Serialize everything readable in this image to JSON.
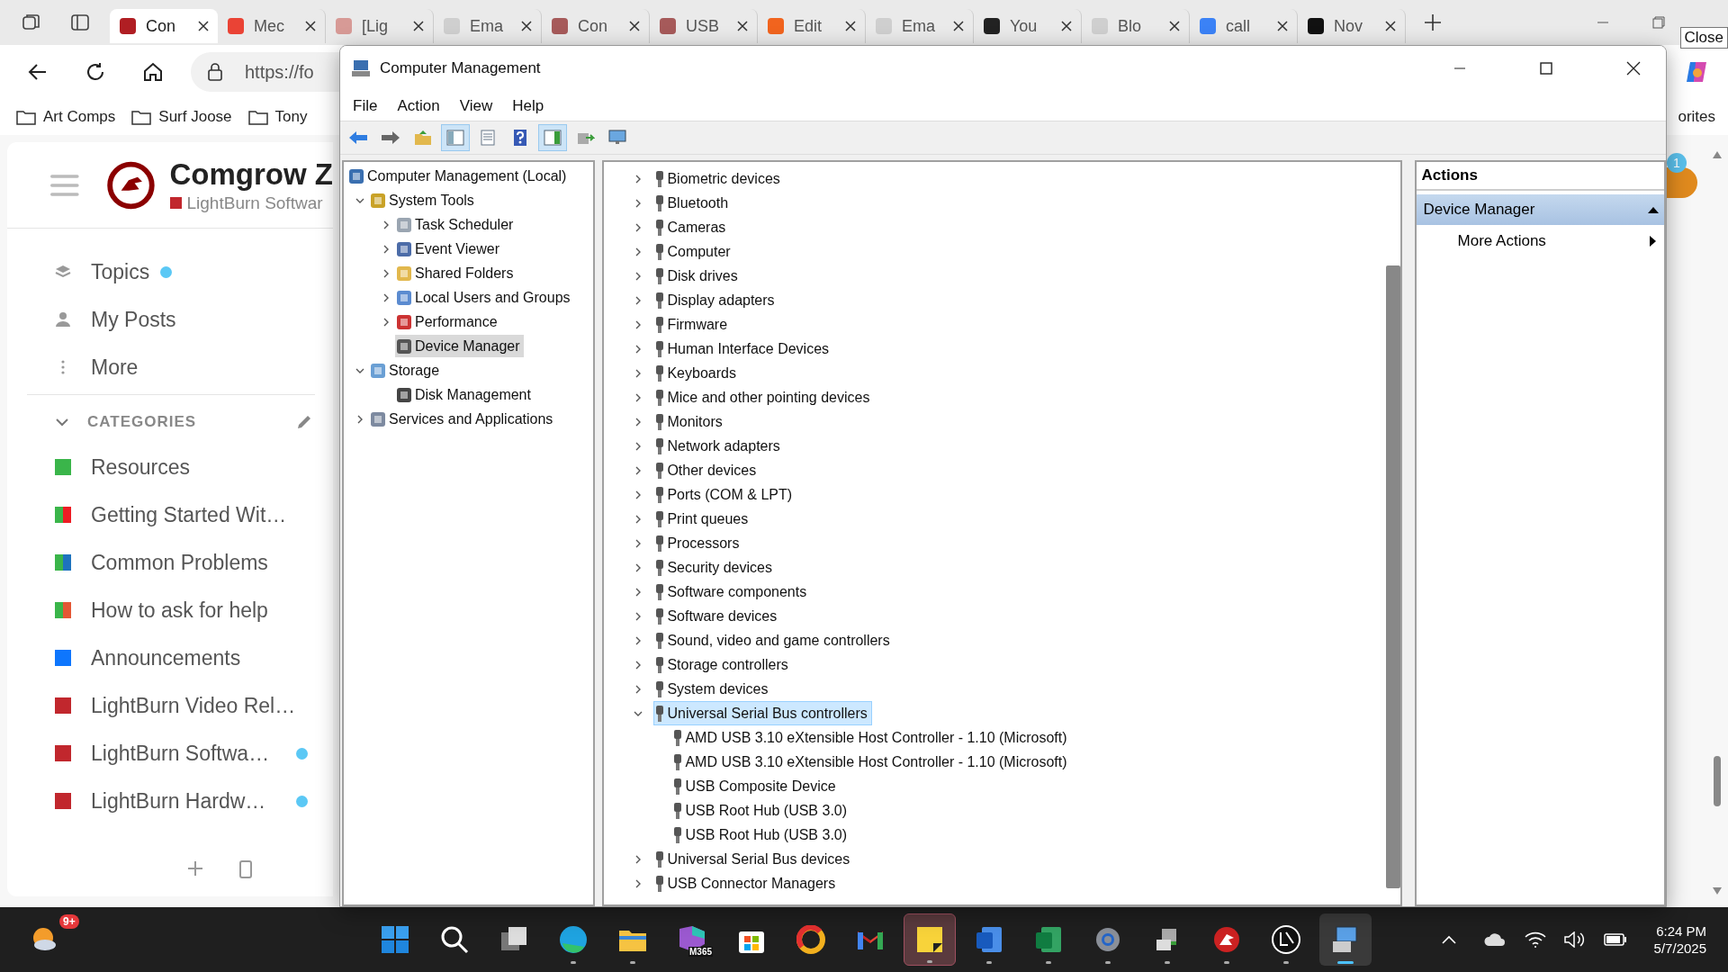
{
  "browser": {
    "tabs": [
      {
        "label": "Con",
        "kind": "comgrow",
        "selected": true
      },
      {
        "label": "Mec",
        "kind": "gmail",
        "selected": false
      },
      {
        "label": "[Lig",
        "kind": "gmail-grey",
        "selected": false
      },
      {
        "label": "Ema",
        "kind": "wix",
        "selected": false
      },
      {
        "label": "Con",
        "kind": "comgrow-grey",
        "selected": false
      },
      {
        "label": "USB",
        "kind": "comgrow-grey",
        "selected": false
      },
      {
        "label": "Edit",
        "kind": "etsy",
        "selected": false
      },
      {
        "label": "Ema",
        "kind": "wix",
        "selected": false
      },
      {
        "label": "You",
        "kind": "amazon",
        "selected": false
      },
      {
        "label": "Blo",
        "kind": "wix",
        "selected": false
      },
      {
        "label": "call",
        "kind": "search",
        "selected": false
      },
      {
        "label": "Nov",
        "kind": "openai",
        "selected": false
      }
    ],
    "address": "https://fo",
    "bookmarks": [
      "Art Comps",
      "Surf Joose",
      "Tony"
    ],
    "bookmarks_overflow": "orites",
    "tooltip": "Close"
  },
  "forum": {
    "title": "Comgrow Z",
    "subtitle": "LightBurn Softwar",
    "notification_count": "1",
    "nav": [
      {
        "label": "Topics",
        "kind": "layers",
        "unread": true
      },
      {
        "label": "My Posts",
        "kind": "person",
        "unread": false
      },
      {
        "label": "More",
        "kind": "dots",
        "unread": false
      }
    ],
    "categories_heading": "CATEGORIES",
    "categories": [
      {
        "name": "Resources",
        "colors": [
          {
            "color": "#3ab54a"
          }
        ],
        "unread": false
      },
      {
        "name": "Getting Started Wit…",
        "colors": [
          {
            "color": "#3ab54a"
          },
          {
            "color": "#ed1c24"
          }
        ],
        "unread": false
      },
      {
        "name": "Common Problems",
        "colors": [
          {
            "color": "#3ab54a"
          },
          {
            "color": "#1e73be"
          }
        ],
        "unread": false
      },
      {
        "name": "How to ask for help",
        "colors": [
          {
            "color": "#3ab54a"
          },
          {
            "color": "#e45735"
          }
        ],
        "unread": false
      },
      {
        "name": "Announcements",
        "colors": [
          {
            "color": "#0e76fd"
          }
        ],
        "unread": false
      },
      {
        "name": "LightBurn Video Rel…",
        "colors": [
          {
            "color": "#c1272d"
          }
        ],
        "unread": false
      },
      {
        "name": "LightBurn Softwa…",
        "colors": [
          {
            "color": "#c1272d"
          }
        ],
        "unread": true
      },
      {
        "name": "LightBurn Hardw…",
        "colors": [
          {
            "color": "#c1272d"
          }
        ],
        "unread": true
      }
    ]
  },
  "window": {
    "title": "Computer Management",
    "menu": [
      "File",
      "Action",
      "View",
      "Help"
    ],
    "toolbar": [
      {
        "kind": "back",
        "pressed": false
      },
      {
        "kind": "forward",
        "pressed": false
      },
      {
        "kind": "up",
        "pressed": false
      },
      {
        "kind": "tree",
        "pressed": true
      },
      {
        "kind": "properties",
        "pressed": false
      },
      {
        "kind": "help",
        "pressed": false
      },
      {
        "kind": "pane",
        "pressed": true
      },
      {
        "kind": "export",
        "pressed": false
      },
      {
        "kind": "monitor",
        "pressed": false
      }
    ],
    "tree": [
      {
        "label": "Computer Management (Local)",
        "kind": "computer",
        "selected": false,
        "children": [
          {
            "label": "System Tools",
            "kind": "tools",
            "expanded": true,
            "selected": false,
            "children": [
              {
                "label": "Task Scheduler",
                "kind": "clock",
                "expanded": false,
                "selected": false
              },
              {
                "label": "Event Viewer",
                "kind": "log",
                "expanded": false,
                "selected": false
              },
              {
                "label": "Shared Folders",
                "kind": "folder",
                "expanded": false,
                "selected": false
              },
              {
                "label": "Local Users and Groups",
                "kind": "users",
                "expanded": false,
                "selected": false
              },
              {
                "label": "Performance",
                "kind": "gauge",
                "expanded": false,
                "selected": false
              },
              {
                "label": "Device Manager",
                "kind": "device",
                "selected": true
              }
            ]
          },
          {
            "label": "Storage",
            "kind": "storage",
            "expanded": true,
            "selected": false,
            "children": [
              {
                "label": "Disk Management",
                "kind": "disk",
                "selected": false
              }
            ]
          },
          {
            "label": "Services and Applications",
            "kind": "services",
            "expanded": false,
            "selected": false
          }
        ]
      }
    ],
    "devices": [
      {
        "label": "Biometric devices",
        "expanded": false,
        "selected": false
      },
      {
        "label": "Bluetooth",
        "expanded": false,
        "selected": false
      },
      {
        "label": "Cameras",
        "expanded": false,
        "selected": false
      },
      {
        "label": "Computer",
        "expanded": false,
        "selected": false
      },
      {
        "label": "Disk drives",
        "expanded": false,
        "selected": false
      },
      {
        "label": "Display adapters",
        "expanded": false,
        "selected": false
      },
      {
        "label": "Firmware",
        "expanded": false,
        "selected": false
      },
      {
        "label": "Human Interface Devices",
        "expanded": false,
        "selected": false
      },
      {
        "label": "Keyboards",
        "expanded": false,
        "selected": false
      },
      {
        "label": "Mice and other pointing devices",
        "expanded": false,
        "selected": false
      },
      {
        "label": "Monitors",
        "expanded": false,
        "selected": false
      },
      {
        "label": "Network adapters",
        "expanded": false,
        "selected": false
      },
      {
        "label": "Other devices",
        "expanded": false,
        "selected": false
      },
      {
        "label": "Ports (COM & LPT)",
        "expanded": false,
        "selected": false
      },
      {
        "label": "Print queues",
        "expanded": false,
        "selected": false
      },
      {
        "label": "Processors",
        "expanded": false,
        "selected": false
      },
      {
        "label": "Security devices",
        "expanded": false,
        "selected": false
      },
      {
        "label": "Software components",
        "expanded": false,
        "selected": false
      },
      {
        "label": "Software devices",
        "expanded": false,
        "selected": false
      },
      {
        "label": "Sound, video and game controllers",
        "expanded": false,
        "selected": false
      },
      {
        "label": "Storage controllers",
        "expanded": false,
        "selected": false
      },
      {
        "label": "System devices",
        "expanded": false,
        "selected": false
      },
      {
        "label": "Universal Serial Bus controllers",
        "expanded": true,
        "selected": true,
        "children": [
          {
            "label": "AMD USB 3.10 eXtensible Host Controller - 1.10 (Microsoft)",
            "selected": false
          },
          {
            "label": "AMD USB 3.10 eXtensible Host Controller - 1.10 (Microsoft)",
            "selected": false
          },
          {
            "label": "USB Composite Device",
            "selected": false
          },
          {
            "label": "USB Root Hub (USB 3.0)",
            "selected": false
          },
          {
            "label": "USB Root Hub (USB 3.0)",
            "selected": false
          }
        ]
      },
      {
        "label": "Universal Serial Bus devices",
        "expanded": false,
        "selected": false
      },
      {
        "label": "USB Connector Managers",
        "expanded": false,
        "selected": false
      }
    ],
    "actions": {
      "heading": "Actions",
      "section": "Device Manager",
      "items": [
        "More Actions"
      ]
    }
  },
  "taskbar": {
    "notification_badge": "9+",
    "apps": [
      {
        "kind": "start",
        "running": false,
        "selected": false
      },
      {
        "kind": "search",
        "running": false,
        "selected": false
      },
      {
        "kind": "taskview",
        "running": false,
        "selected": false
      },
      {
        "kind": "edge",
        "running": true,
        "selected": false
      },
      {
        "kind": "explorer",
        "running": true,
        "selected": false
      },
      {
        "kind": "m365",
        "label": "M365",
        "running": false,
        "selected": false
      },
      {
        "kind": "store",
        "running": false,
        "selected": false
      },
      {
        "kind": "ring",
        "running": false,
        "selected": false
      },
      {
        "kind": "gmail",
        "running": false,
        "selected": false
      },
      {
        "kind": "sticky",
        "running": true,
        "selected": false,
        "hovered": true
      },
      {
        "kind": "word",
        "running": true,
        "selected": false
      },
      {
        "kind": "excel",
        "running": true,
        "selected": false
      },
      {
        "kind": "settings",
        "running": true,
        "selected": false
      },
      {
        "kind": "device",
        "running": true,
        "selected": false
      },
      {
        "kind": "dragon",
        "running": true,
        "selected": false
      },
      {
        "kind": "lightburn",
        "running": true,
        "selected": false
      },
      {
        "kind": "compmgmt",
        "running": true,
        "selected": true
      }
    ],
    "time": "6:24 PM",
    "date": "5/7/2025"
  }
}
